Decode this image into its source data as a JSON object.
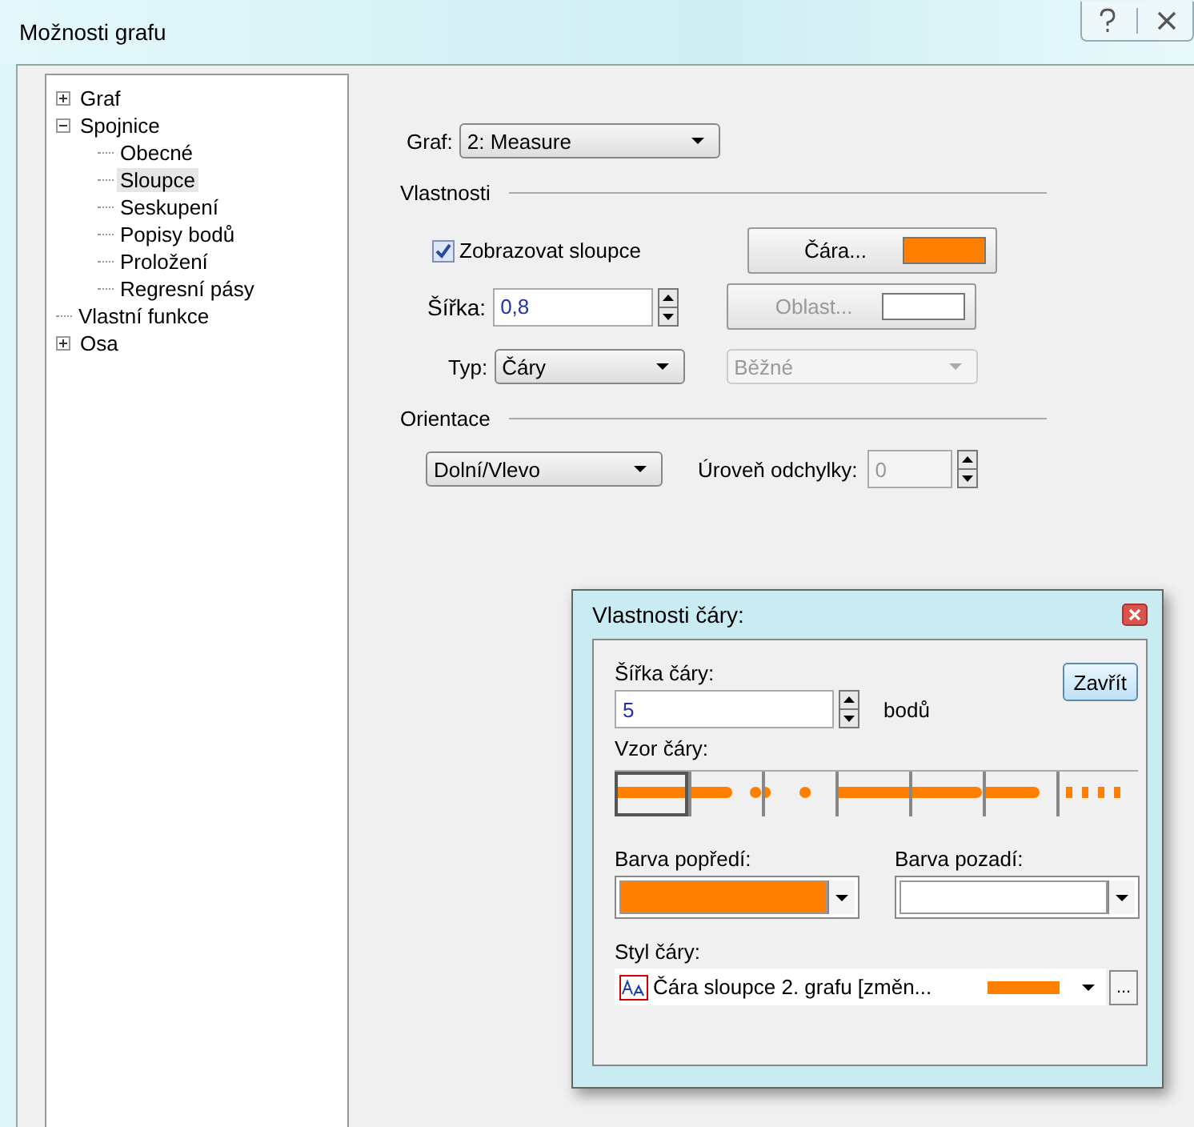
{
  "window": {
    "title": "Možnosti grafu"
  },
  "tree": [
    {
      "label": "Graf",
      "expanded": false,
      "selected": false
    },
    {
      "label": "Spojnice",
      "expanded": true,
      "selected": false,
      "children": [
        {
          "label": "Obecné",
          "selected": false
        },
        {
          "label": "Sloupce",
          "selected": true
        },
        {
          "label": "Seskupení",
          "selected": false
        },
        {
          "label": "Popisy bodů",
          "selected": false
        },
        {
          "label": "Proložení",
          "selected": false
        },
        {
          "label": "Regresní pásy",
          "selected": false
        }
      ]
    },
    {
      "label": "Vlastní funkce",
      "selected": false
    },
    {
      "label": "Osa",
      "expanded": false,
      "selected": false
    }
  ],
  "graf": {
    "label": "Graf:",
    "value": "2: Measure"
  },
  "properties": {
    "heading": "Vlastnosti",
    "show_columns": {
      "label": "Zobrazovat sloupce",
      "checked": true
    },
    "line_button": {
      "label": "Čára...",
      "color": "#ff8000",
      "disabled": false
    },
    "width": {
      "label": "Šířka:",
      "value": "0,8"
    },
    "area_button": {
      "label": "Oblast...",
      "color": "#ffffff",
      "disabled": true
    },
    "type": {
      "label": "Typ:",
      "value": "Čáry"
    },
    "subtype": {
      "value": "Běžné",
      "disabled": true
    }
  },
  "orientation": {
    "heading": "Orientace",
    "value": "Dolní/Vlevo",
    "deviation_label": "Úroveň odchylky:",
    "deviation_value": "0",
    "deviation_disabled": true
  },
  "line_dialog": {
    "title": "Vlastnosti čáry:",
    "width_label": "Šířka čáry:",
    "width_value": "5",
    "unit": "bodů",
    "close_button": "Zavřít",
    "pattern_label": "Vzor čáry:",
    "patterns": [
      {
        "kind": "solid",
        "selected": true
      },
      {
        "kind": "dash-dot",
        "selected": false
      },
      {
        "kind": "dot",
        "selected": false
      },
      {
        "kind": "long-dash",
        "selected": false
      },
      {
        "kind": "dash",
        "selected": false
      },
      {
        "kind": "dash-gap",
        "selected": false
      },
      {
        "kind": "short-dash",
        "selected": false
      }
    ],
    "foreground": {
      "label": "Barva popředí:",
      "color": "#ff8000"
    },
    "background": {
      "label": "Barva pozadí:",
      "color": "#ffffff"
    },
    "style": {
      "label": "Styl čáry:",
      "value": "Čára sloupce 2. grafu [změn...",
      "color": "#ff8000"
    },
    "more_button": "..."
  }
}
